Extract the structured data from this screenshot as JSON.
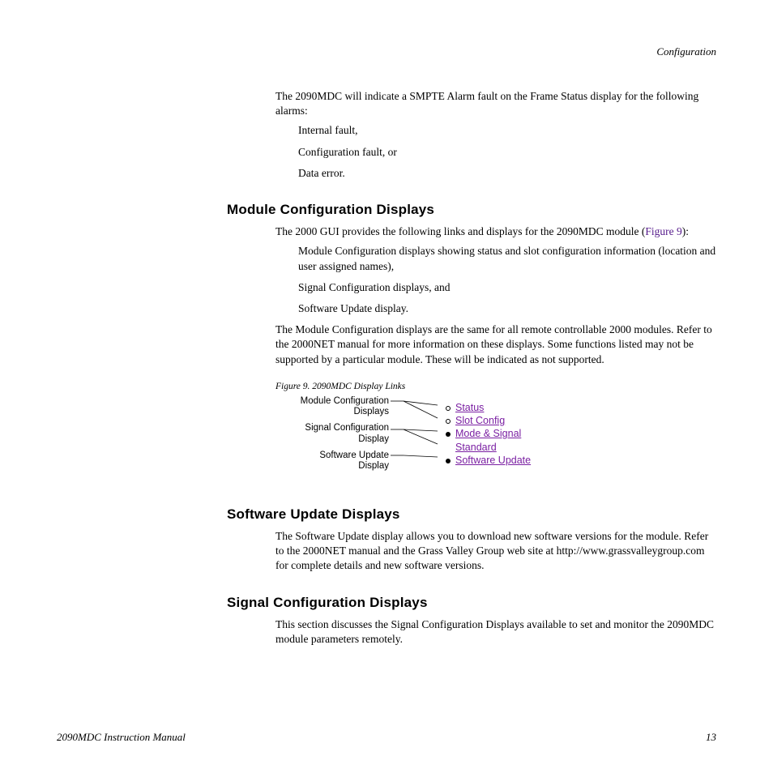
{
  "header": {
    "section": "Configuration"
  },
  "intro": {
    "lead": "The 2090MDC will indicate a SMPTE Alarm fault on the Frame Status display for the following alarms:",
    "items": [
      "Internal fault,",
      "Configuration fault, or",
      "Data error."
    ]
  },
  "mcd": {
    "heading": "Module Configuration Displays",
    "p1a": "The 2000 GUI provides the following links and displays for the 2090MDC module (",
    "p1_link": "Figure 9",
    "p1b": "):",
    "items": [
      "Module Configuration displays showing status and slot configuration information (location and user assigned names),",
      "Signal Configuration displays, and",
      "Software Update display."
    ],
    "p2": "The Module Configuration displays are the same for all remote controllable 2000 modules. Refer to the 2000NET manual for more information on these displays. Some functions listed may not be supported by a particular module. These will be indicated as not supported."
  },
  "figure": {
    "caption": "Figure 9.  2090MDC Display Links",
    "labels": {
      "l1a": "Module Configuration",
      "l1b": "Displays",
      "l2a": "Signal Configuration",
      "l2b": "Display",
      "l3a": "Software Update",
      "l3b": "Display"
    },
    "links": {
      "k1": "Status",
      "k2": "Slot Config",
      "k3": "Mode & Signal",
      "k4": "Standard",
      "k5": "Software Update"
    }
  },
  "sud": {
    "heading": "Software Update Displays",
    "p1": "The Software Update display allows you to download new software versions for the module. Refer to the 2000NET manual and the Grass Valley Group web site at http://www.grassvalleygroup.com for complete details and new software versions."
  },
  "scd": {
    "heading": "Signal Configuration Displays",
    "p1": "This section discusses the Signal Configuration Displays available to set and monitor the 2090MDC module parameters remotely."
  },
  "footer": {
    "title": "2090MDC Instruction Manual",
    "page": "13"
  }
}
